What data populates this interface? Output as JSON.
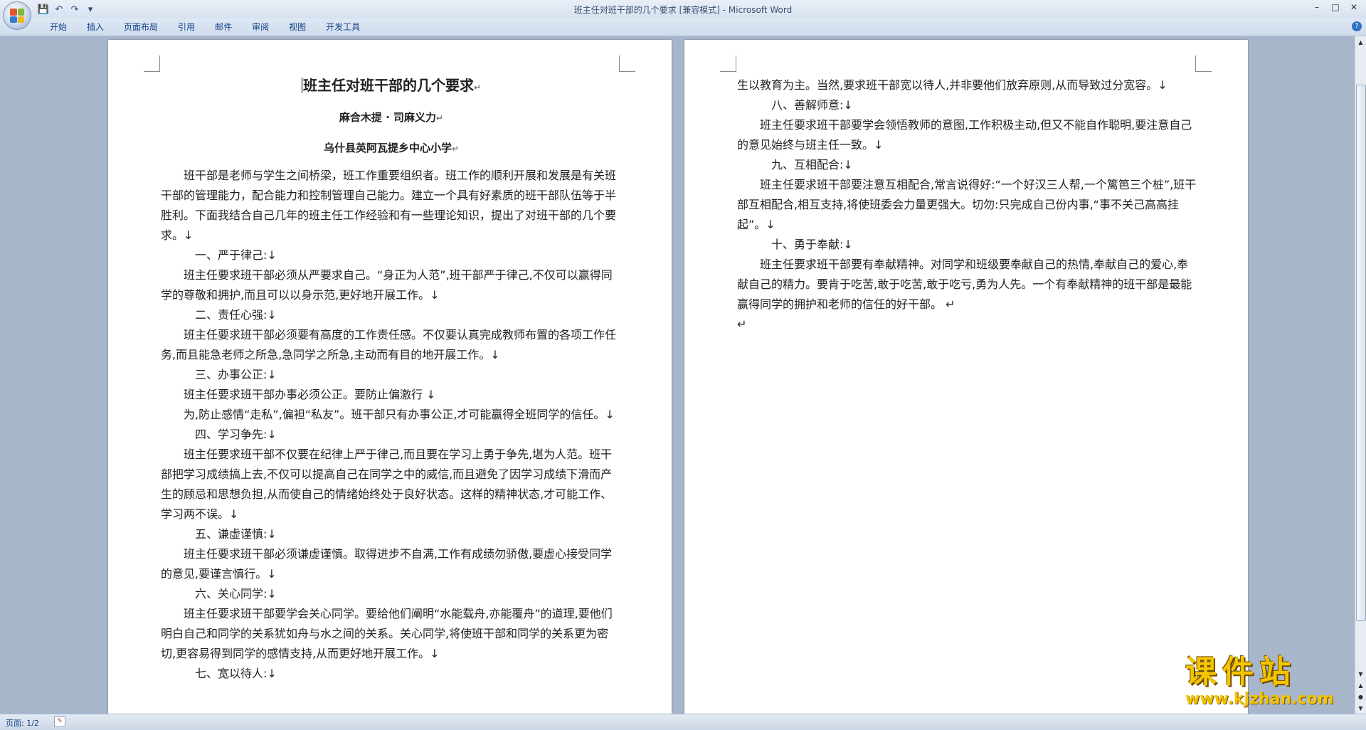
{
  "window": {
    "title": "班主任对班干部的几个要求 [兼容模式] - Microsoft Word",
    "controls": [
      "–",
      "□",
      "✕"
    ]
  },
  "quick_access": [
    "💾",
    "↶",
    "↷",
    "▾"
  ],
  "ribbon": {
    "tabs": [
      "开始",
      "插入",
      "页面布局",
      "引用",
      "邮件",
      "审阅",
      "视图",
      "开发工具"
    ],
    "help": "?"
  },
  "document": {
    "title": "班主任对班干部的几个要求",
    "author": "麻合木提 · 司麻义力",
    "school": "乌什县英阿瓦提乡中心小学",
    "mark": "↵",
    "left_page": [
      {
        "type": "p",
        "text": "班干部是老师与学生之间桥梁，班工作重要组织者。班工作的顺利开展和发展是有关班干部的管理能力，配合能力和控制管理自己能力。建立一个具有好素质的班干部队伍等于半胜利。下面我结合自己几年的班主任工作经验和有一些理论知识，提出了对班干部的几个要求。↓"
      },
      {
        "type": "h",
        "text": "一、严于律己:↓"
      },
      {
        "type": "p",
        "text": "班主任要求班干部必须从严要求自己。“身正为人范”,班干部严于律己,不仅可以赢得同学的尊敬和拥护,而且可以以身示范,更好地开展工作。↓"
      },
      {
        "type": "h",
        "text": "二、责任心强:↓"
      },
      {
        "type": "p",
        "text": "班主任要求班干部必须要有高度的工作责任感。不仅要认真完成教师布置的各项工作任务,而且能急老师之所急,急同学之所急,主动而有目的地开展工作。↓"
      },
      {
        "type": "h",
        "text": "三、办事公正:↓"
      },
      {
        "type": "p",
        "text": "班主任要求班干部办事必须公正。要防止偏激行 ↓"
      },
      {
        "type": "p",
        "text": "为,防止感情“走私”,偏袒“私友”。班干部只有办事公正,才可能赢得全班同学的信任。↓"
      },
      {
        "type": "h",
        "text": "四、学习争先:↓"
      },
      {
        "type": "p",
        "text": "班主任要求班干部不仅要在纪律上严于律己,而且要在学习上勇于争先,堪为人范。班干部把学习成绩搞上去,不仅可以提高自己在同学之中的威信,而且避免了因学习成绩下滑而产生的顾忌和思想负担,从而使自己的情绪始终处于良好状态。这样的精神状态,才可能工作、学习两不误。↓"
      },
      {
        "type": "h",
        "text": "五、谦虚谨慎:↓"
      },
      {
        "type": "p",
        "text": "班主任要求班干部必须谦虚谨慎。取得进步不自满,工作有成绩勿骄傲,要虚心接受同学的意见,要谨言慎行。↓"
      },
      {
        "type": "h",
        "text": "六、关心同学:↓"
      },
      {
        "type": "p",
        "text": "班主任要求班干部要学会关心同学。要给他们阐明“水能载舟,亦能覆舟”的道理,要他们明白自己和同学的关系犹如舟与水之间的关系。关心同学,将使班干部和同学的关系更为密切,更容易得到同学的感情支持,从而更好地开展工作。↓"
      },
      {
        "type": "h",
        "text": "七、宽以待人:↓"
      }
    ],
    "right_page": [
      {
        "type": "pn",
        "text": "生以教育为主。当然,要求班干部宽以待人,并非要他们放弃原则,从而导致过分宽容。↓"
      },
      {
        "type": "h",
        "text": "八、善解师意:↓"
      },
      {
        "type": "p",
        "text": "班主任要求班干部要学会领悟教师的意图,工作积极主动,但又不能自作聪明,要注意自己的意见始终与班主任一致。↓"
      },
      {
        "type": "h",
        "text": "九、互相配合:↓"
      },
      {
        "type": "p",
        "text": "班主任要求班干部要注意互相配合,常言说得好:“一个好汉三人帮,一个篱笆三个桩”,班干部互相配合,相互支持,将使班委会力量更强大。切勿:只完成自己份内事,“事不关己高高挂起”。↓"
      },
      {
        "type": "h",
        "text": "十、勇于奉献:↓"
      },
      {
        "type": "p",
        "text": "班主任要求班干部要有奉献精神。对同学和班级要奉献自己的热情,奉献自己的爱心,奉献自己的精力。要肯于吃苦,敢于吃苦,敢于吃亏,勇为人先。一个有奉献精神的班干部是最能赢得同学的拥护和老师的信任的好干部。 ↵"
      },
      {
        "type": "pn",
        "text": "↵"
      }
    ]
  },
  "scrollbar": {
    "up": "▲",
    "down": "▼",
    "prev_page": "▲",
    "browse": "●",
    "next_page": "▼"
  },
  "status": {
    "page": "页面: 1/2",
    "icon": "✎"
  },
  "watermark": {
    "cn": "课件站",
    "url": "www.kjzhan.com"
  },
  "colors": {
    "page": "#ffffff",
    "workspace": "#a8b6cc",
    "ribbon_text": "#15428b",
    "watermark": "#f5c400"
  }
}
